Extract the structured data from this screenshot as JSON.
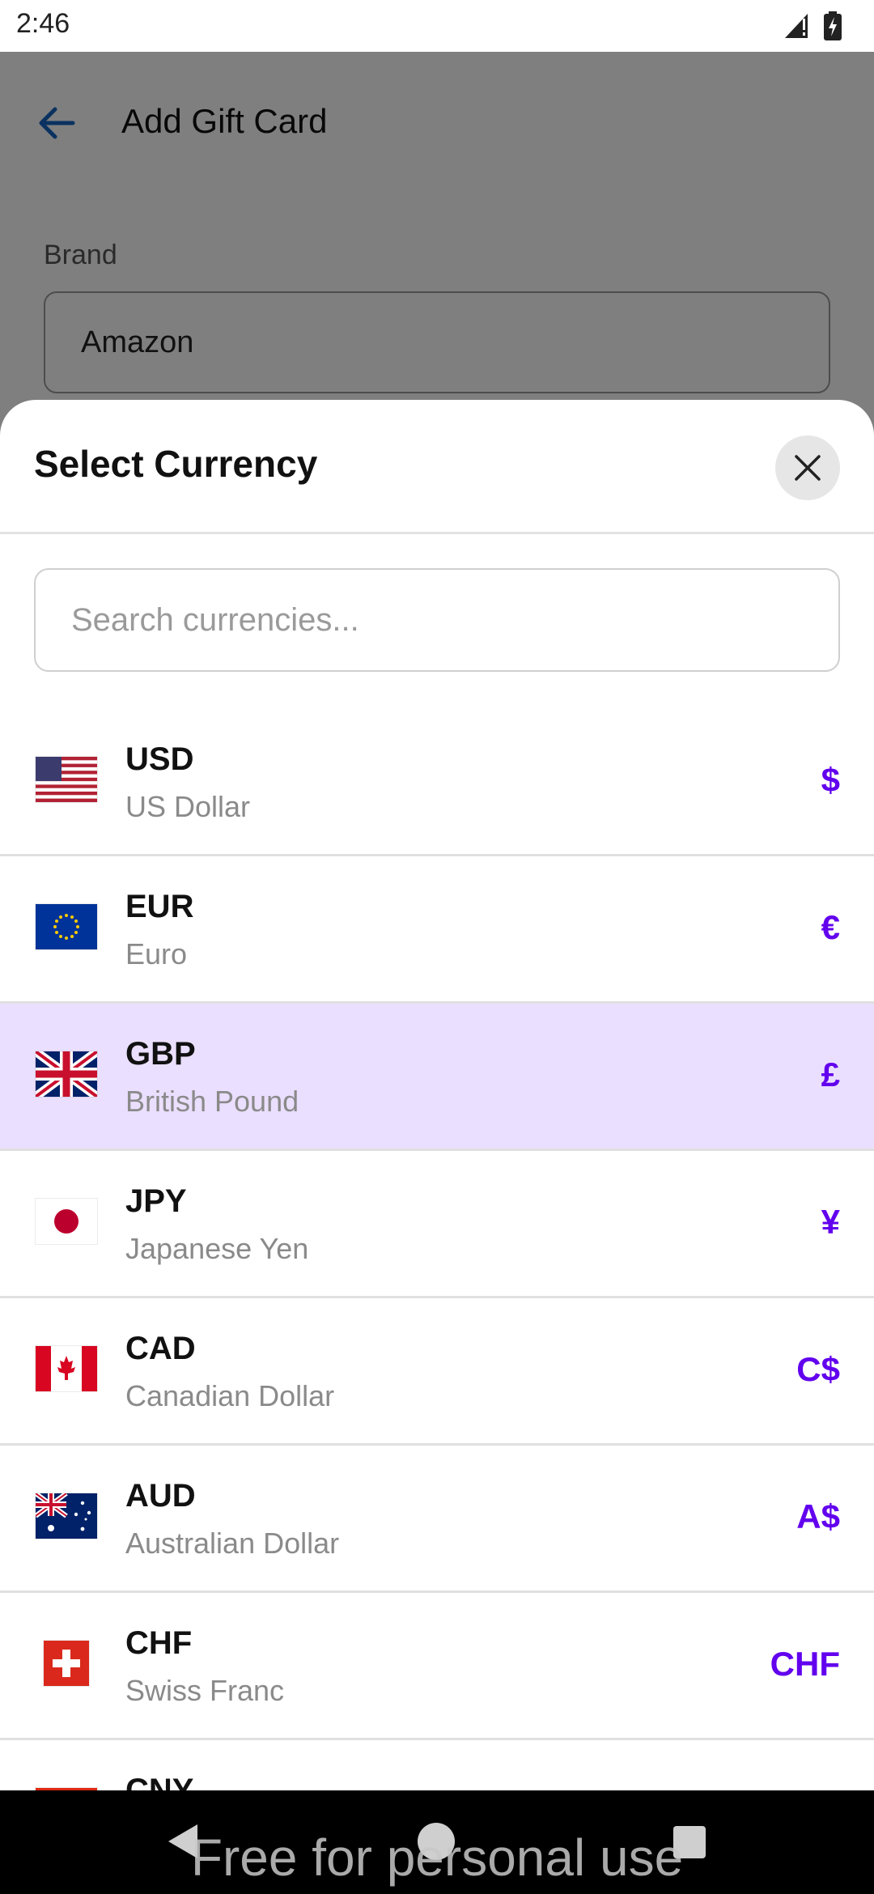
{
  "status_bar": {
    "time": "2:46"
  },
  "background_screen": {
    "title": "Add Gift Card",
    "brand_label": "Brand",
    "brand_value": "Amazon"
  },
  "sheet": {
    "title": "Select Currency",
    "search_placeholder": "Search currencies...",
    "currencies": [
      {
        "code": "USD",
        "name": "US Dollar",
        "symbol": "$",
        "flag": "us-flag-icon",
        "selected": false
      },
      {
        "code": "EUR",
        "name": "Euro",
        "symbol": "€",
        "flag": "eu-flag-icon",
        "selected": false
      },
      {
        "code": "GBP",
        "name": "British Pound",
        "symbol": "£",
        "flag": "gb-flag-icon",
        "selected": true
      },
      {
        "code": "JPY",
        "name": "Japanese Yen",
        "symbol": "¥",
        "flag": "jp-flag-icon",
        "selected": false
      },
      {
        "code": "CAD",
        "name": "Canadian Dollar",
        "symbol": "C$",
        "flag": "ca-flag-icon",
        "selected": false
      },
      {
        "code": "AUD",
        "name": "Australian Dollar",
        "symbol": "A$",
        "flag": "au-flag-icon",
        "selected": false
      },
      {
        "code": "CHF",
        "name": "Swiss Franc",
        "symbol": "CHF",
        "flag": "ch-flag-icon",
        "selected": false
      },
      {
        "code": "CNY",
        "name": "",
        "symbol": "",
        "flag": "cn-flag-icon",
        "selected": false
      }
    ]
  },
  "watermark": "Free for personal use",
  "colors": {
    "accent": "#6200ee",
    "selected_row": "#ebdfff",
    "back_arrow": "#1565c0"
  }
}
